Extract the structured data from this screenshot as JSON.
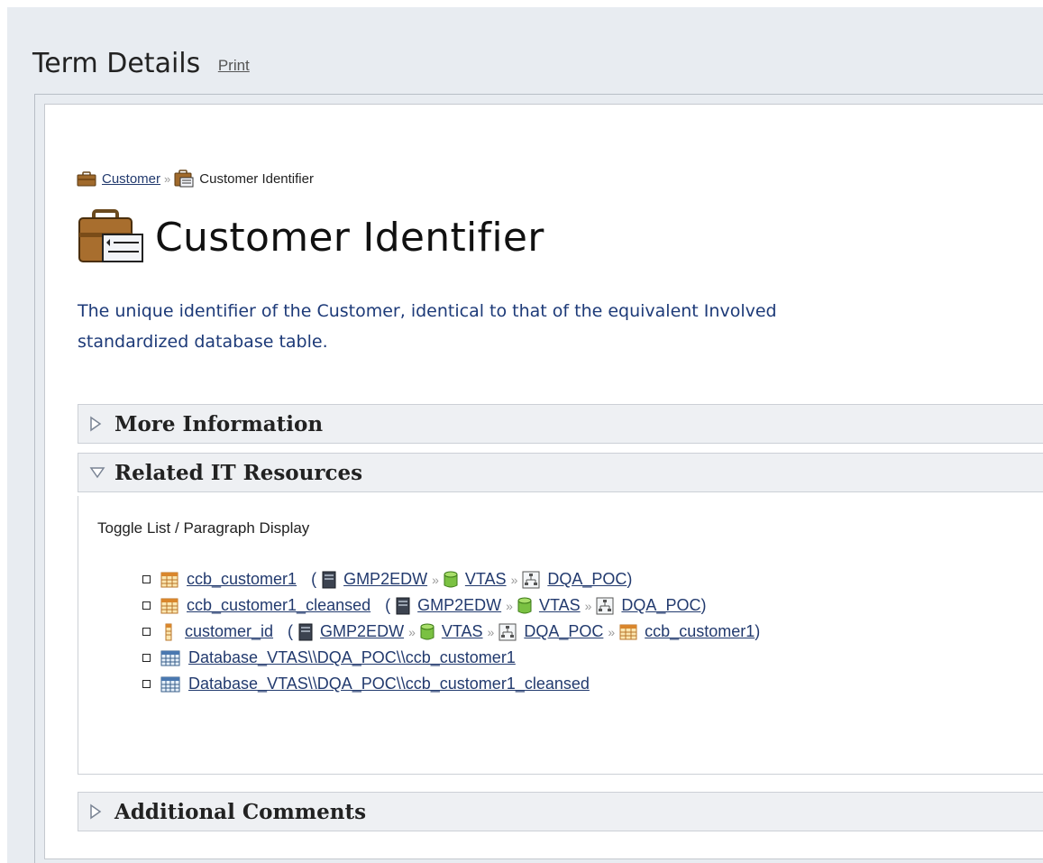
{
  "header": {
    "title": "Term Details",
    "print_label": "Print"
  },
  "breadcrumb": {
    "parent": "Customer",
    "separator": "»",
    "current": "Customer Identifier"
  },
  "term": {
    "title": "Customer Identifier",
    "description_line1": "The unique identifier of the Customer, identical to that of the equivalent Involved",
    "description_line2": "standardized database table."
  },
  "sections": {
    "more_info": "More Information",
    "related": "Related IT Resources",
    "comments": "Additional Comments"
  },
  "toggle_label": "Toggle List / Paragraph Display",
  "resources": {
    "r0": {
      "name": "ccb_customer1",
      "icon": "table-icon",
      "path": [
        "GMP2EDW",
        "VTAS",
        "DQA_POC"
      ]
    },
    "r1": {
      "name": "ccb_customer1_cleansed",
      "icon": "table-icon",
      "path": [
        "GMP2EDW",
        "VTAS",
        "DQA_POC"
      ]
    },
    "r2": {
      "name": "customer_id",
      "icon": "column-icon",
      "path": [
        "GMP2EDW",
        "VTAS",
        "DQA_POC",
        "ccb_customer1"
      ]
    },
    "r3": {
      "name": "Database_VTAS\\\\DQA_POC\\\\ccb_customer1",
      "icon": "grid-table-icon"
    },
    "r4": {
      "name": "Database_VTAS\\\\DQA_POC\\\\ccb_customer1_cleansed",
      "icon": "grid-table-icon"
    }
  },
  "colors": {
    "link": "#223a6e",
    "description": "#1d3a78",
    "background": "#e8ecf1"
  }
}
